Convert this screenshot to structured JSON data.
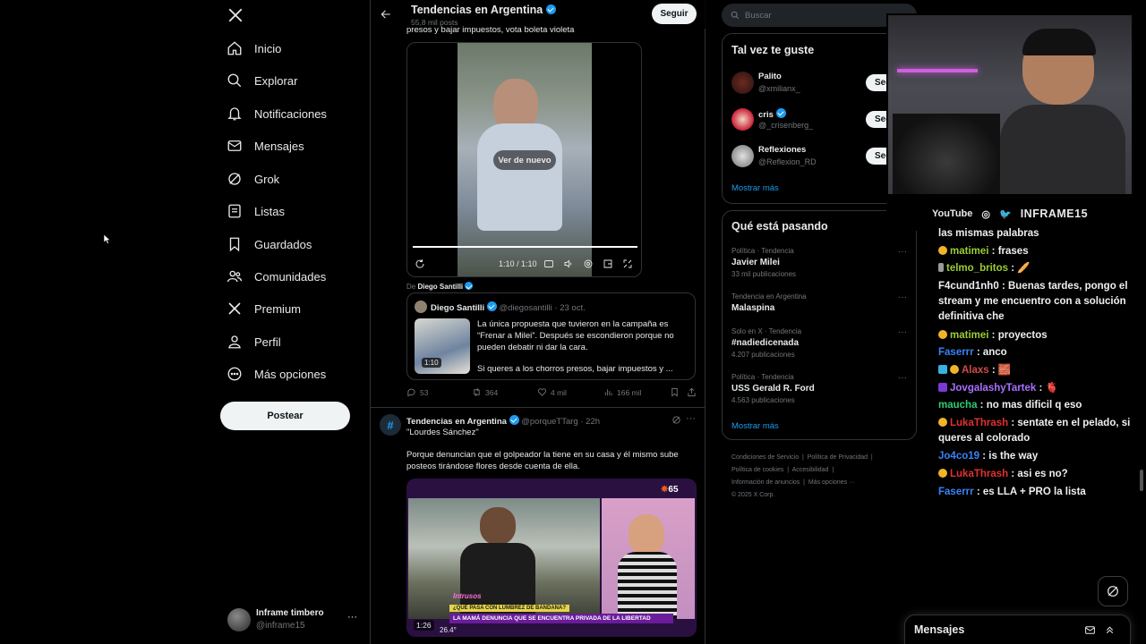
{
  "nav": {
    "items": [
      {
        "label": "Inicio",
        "icon": "home-icon"
      },
      {
        "label": "Explorar",
        "icon": "search-icon"
      },
      {
        "label": "Notificaciones",
        "icon": "bell-icon"
      },
      {
        "label": "Mensajes",
        "icon": "mail-icon"
      },
      {
        "label": "Grok",
        "icon": "grok-icon"
      },
      {
        "label": "Listas",
        "icon": "list-icon"
      },
      {
        "label": "Guardados",
        "icon": "bookmark-icon"
      },
      {
        "label": "Comunidades",
        "icon": "people-icon"
      },
      {
        "label": "Premium",
        "icon": "x-logo-icon"
      },
      {
        "label": "Perfil",
        "icon": "user-icon"
      },
      {
        "label": "Más opciones",
        "icon": "more-circle-icon"
      }
    ],
    "post_label": "Postear",
    "account": {
      "name": "Inframe timbero",
      "handle": "@inframe15"
    }
  },
  "header": {
    "title": "Tendencias en Argentina",
    "posts": "55,8 mil posts",
    "follow": "Seguir"
  },
  "tweet1": {
    "text_top": "presos y bajar impuestos, vota boleta violeta",
    "video": {
      "replay": "Ver de nuevo",
      "time": "1:10 / 1:10",
      "progress": 1.0
    },
    "from_label": "De",
    "from_name": "Diego Santilli",
    "quote": {
      "name": "Diego Santilli",
      "handle": "@diegosantilli",
      "date": "· 23 oct.",
      "text1": "La única propuesta que tuvieron en la campaña es “Frenar a Milei”. Después se escondieron porque no pueden debatir ni dar la cara.",
      "text2": "Si queres a los chorros presos, bajar impuestos y ...",
      "duration": "1:10"
    },
    "stats": {
      "replies": "53",
      "retweets": "364",
      "likes": "4 mil",
      "views": "166 mil"
    }
  },
  "tweet2": {
    "name": "Tendencias en Argentina",
    "handle": "@porqueTTarg",
    "time": "· 22h",
    "line1": "\"Lourdes Sánchez\"",
    "line2": "Porque denuncian que el golpeador la tiene en su casa y él mismo sube posteos tirándose flores desde cuenta de ella.",
    "video": {
      "duration": "1:26",
      "temp": "26.4°",
      "channel": "65",
      "ticker1": "¿QUÉ PASA CON LUMBREZ DE BANDANA?",
      "ticker2": "LA MAMÁ DENUNCIA QUE SE ENCUENTRA PRIVADA DE LA LIBERTAD",
      "brand": "Intrusos"
    }
  },
  "search": {
    "placeholder": "Buscar"
  },
  "suggest": {
    "title": "Tal vez te guste",
    "users": [
      {
        "name": "Palito",
        "handle": "@xmilianx_",
        "btn": "Seg",
        "verified": false
      },
      {
        "name": "cris",
        "handle": "@_crisenberg_",
        "btn": "Seg",
        "verified": true
      },
      {
        "name": "Reflexiones",
        "handle": "@Reflexion_RD",
        "btn": "Seg",
        "verified": false
      }
    ],
    "more": "Mostrar más"
  },
  "trends": {
    "title": "Qué está pasando",
    "items": [
      {
        "meta": "Política · Tendencia",
        "name": "Javier Milei",
        "count": "33 mil publicaciones"
      },
      {
        "meta": "Tendencia en Argentina",
        "name": "Malaspina",
        "count": ""
      },
      {
        "meta": "Solo en X · Tendencia",
        "name": "#nadiedicenada",
        "count": "4.207 publicaciones"
      },
      {
        "meta": "Política · Tendencia",
        "name": "USS Gerald R. Ford",
        "count": "4.563 publicaciones"
      }
    ],
    "more": "Mostrar más"
  },
  "footer": {
    "l1": "Condiciones de Servicio",
    "l2": "Política de Privacidad",
    "l3": "Política de cookies",
    "l4": "Accesibilidad",
    "l5": "Información de anuncios",
    "l6": "Más opciones ···",
    "copy": "© 2025 X Corp."
  },
  "webcam": {
    "youtube": "YouTube",
    "channel": "INFRAME15"
  },
  "chat": [
    {
      "user": "",
      "msg": "las mismas palabras",
      "color": "#efeff1",
      "badge": ""
    },
    {
      "user": "matimei",
      "msg": ": frases",
      "color": "#9acd32",
      "badge": "#f0b429"
    },
    {
      "user": "telmo_britos",
      "msg": ": 🥖",
      "color": "#9acd32",
      "badge": "#9a9a9a"
    },
    {
      "user": "F4cund1nh0",
      "msg": ": Buenas tardes, pongo el stream y me encuentro con a solución definitiva che",
      "color": "#efeff1",
      "badge": ""
    },
    {
      "user": "matimei",
      "msg": ": proyectos",
      "color": "#9acd32",
      "badge": "#f0b429"
    },
    {
      "user": "Faserrr",
      "msg": ": anco",
      "color": "#3b82f6",
      "badge": ""
    },
    {
      "user": "Alaxs",
      "msg": ": 🧱",
      "color": "#d14b4b",
      "badge": "#f0b429"
    },
    {
      "user": "JovgalashyTartek",
      "msg": ": 🫀",
      "color": "#a970ff",
      "badge": "#7b3ad6"
    },
    {
      "user": "maucha",
      "msg": ": no mas dificil q eso",
      "color": "#2ecc71",
      "badge": ""
    },
    {
      "user": "LukaThrash",
      "msg": ": sentate en el pelado, si queres al colorado",
      "color": "#e03131",
      "badge": "#f0b429"
    },
    {
      "user": "Jo4co19",
      "msg": ": is the way",
      "color": "#3b82f6",
      "badge": ""
    },
    {
      "user": "LukaThrash",
      "msg": ": asi es no?",
      "color": "#e03131",
      "badge": "#f0b429"
    },
    {
      "user": "Faserrr",
      "msg": ": es LLA + PRO la lista",
      "color": "#3b82f6",
      "badge": ""
    }
  ],
  "dm": {
    "title": "Mensajes"
  }
}
